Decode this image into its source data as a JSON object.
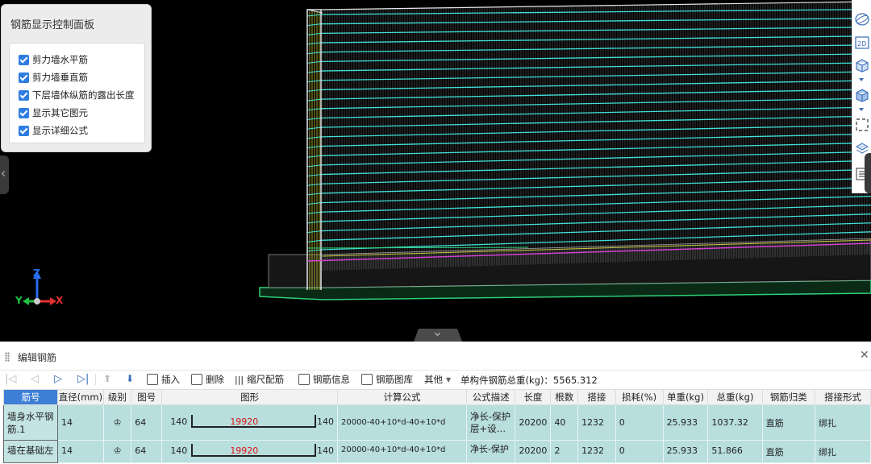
{
  "control_panel": {
    "title": "钢筋显示控制面板",
    "options": [
      {
        "label": "剪力墙水平筋",
        "checked": true
      },
      {
        "label": "剪力墙垂直筋",
        "checked": true
      },
      {
        "label": "下层墙体纵筋的露出长度",
        "checked": true
      },
      {
        "label": "显示其它图元",
        "checked": true
      },
      {
        "label": "显示详细公式",
        "checked": true
      }
    ]
  },
  "axes": {
    "z": "Z",
    "y": "Y",
    "x": "X"
  },
  "colors": {
    "horizontal_bar": "#3fe0d8",
    "vertical_bar": "#bbbbbb",
    "base": "#2fd07a",
    "accent": "#3d7fd6",
    "row_bg": "#b8dede"
  },
  "right_toolbar": [
    "sphere-icon",
    "2d-icon",
    "cube-icon",
    "cube-side-icon",
    "selection-icon",
    "layers-icon",
    "list-icon"
  ],
  "editor": {
    "title": "编辑钢筋",
    "toolbar": {
      "insert": "插入",
      "delete": "删除",
      "scale_rebar": "缩尺配筋",
      "rebar_info": "钢筋信息",
      "rebar_library": "钢筋图库",
      "other": "其他",
      "total_label": "单构件钢筋总重(kg)：5565.312"
    },
    "columns": [
      "筋号",
      "直径(mm)",
      "级别",
      "图号",
      "图形",
      "计算公式",
      "公式描述",
      "长度",
      "根数",
      "搭接",
      "损耗(%)",
      "单重(kg)",
      "总重(kg)",
      "钢筋归类",
      "搭接形式"
    ],
    "rows": [
      {
        "name": "墙身水平钢筋.1",
        "dia": "14",
        "grade": "♔",
        "fig": "64",
        "shape_left": "140",
        "shape_mid": "19920",
        "shape_right": "140",
        "formula": "20000-40+10*d-40+10*d",
        "desc": "净长-保护层+设…",
        "length": "20200",
        "count": "40",
        "lap": "1232",
        "loss": "0",
        "unit_w": "25.933",
        "total_w": "1037.32",
        "category": "直筋",
        "lap_type": "绑扎"
      },
      {
        "name": "墙在基础左",
        "dia": "14",
        "grade": "♔",
        "fig": "64",
        "shape_left": "140",
        "shape_mid": "19920",
        "shape_right": "140",
        "formula": "20000-40+10*d-40+10*d",
        "desc": "净长-保护",
        "length": "20200",
        "count": "2",
        "lap": "1232",
        "loss": "0",
        "unit_w": "25.933",
        "total_w": "51.866",
        "category": "直筋",
        "lap_type": "绑扎"
      }
    ]
  }
}
